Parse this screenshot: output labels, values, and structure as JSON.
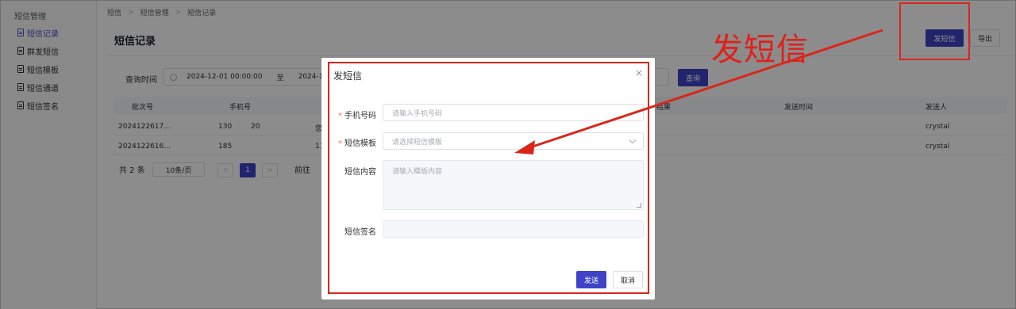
{
  "sidebar": {
    "group": "短信管理",
    "items": [
      {
        "label": "短信记录",
        "active": true
      },
      {
        "label": "群发短信",
        "active": false
      },
      {
        "label": "短信模板",
        "active": false
      },
      {
        "label": "短信通道",
        "active": false
      },
      {
        "label": "短信签名",
        "active": false
      }
    ]
  },
  "breadcrumb": [
    "短信",
    "短信管理",
    "短信记录"
  ],
  "header": {
    "title": "短信记录",
    "send_sms_label": "发短信",
    "export_label": "导出"
  },
  "filter": {
    "label": "查询时间",
    "start": "2024-12-01 00:00:00",
    "separator": "至",
    "end": "2024-12-3",
    "query_label": "查询"
  },
  "table": {
    "headers": [
      "批次号",
      "手机号",
      "结果",
      "发送时间",
      "发送人"
    ],
    "rows": [
      {
        "batch": "2024122617...",
        "phone_a": "130",
        "phone_b": "20",
        "col3": "您",
        "sender": "crystal"
      },
      {
        "batch": "2024122616...",
        "phone_a": "185",
        "phone_b": "",
        "col3": "11",
        "sender": "crystal"
      }
    ]
  },
  "pager": {
    "total": "共 2 条",
    "page_size": "10条/页",
    "current_page": "1",
    "goto": "前往"
  },
  "modal": {
    "title": "发短信",
    "close": "×",
    "fields": {
      "phone_label": "手机号码",
      "phone_placeholder": "请输入手机号码",
      "template_label": "短信模板",
      "template_placeholder": "请选择短信模板",
      "content_label": "短信内容",
      "content_placeholder": "请输入模板内容",
      "signature_label": "短信签名",
      "signature_value": ""
    },
    "send_label": "发送",
    "cancel_label": "取消"
  },
  "annotation": {
    "text": "发短信",
    "color": "#e0211a"
  },
  "colors": {
    "primary": "#3f43c7",
    "annotation_red": "#d9261c"
  }
}
